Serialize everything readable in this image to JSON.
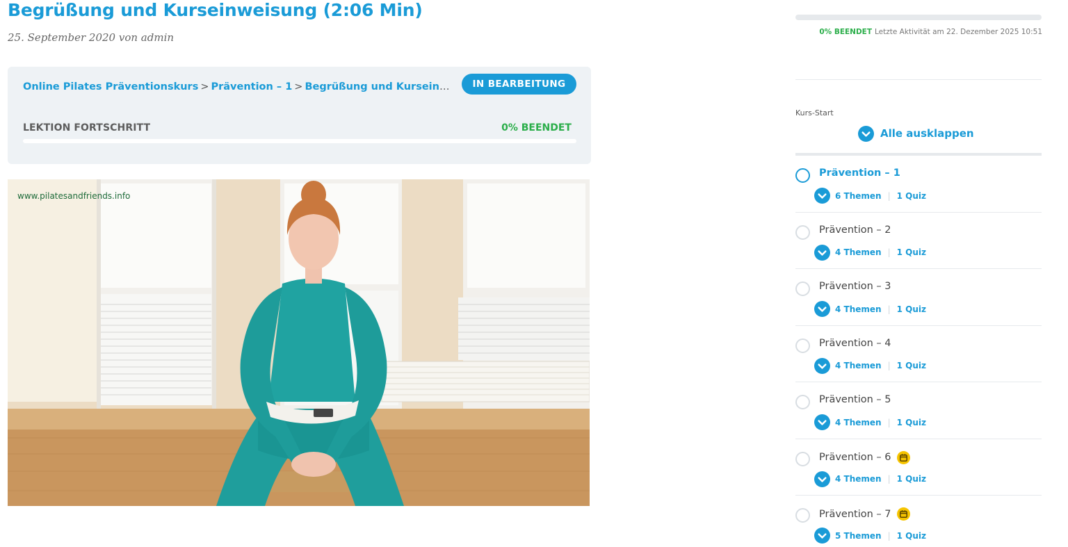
{
  "page": {
    "title": "Begrüßung und Kurseinweisung (2:06 Min)",
    "meta": "25. September 2020 von admin"
  },
  "status_box": {
    "breadcrumb": [
      "Online Pilates Präventionskurs",
      "Prävention – 1",
      "Begrüßung und Kurseinweisung (2:06 Min)"
    ],
    "breadcrumb_separator": ">",
    "badge": "IN BEARBEITUNG",
    "lesson_progress_label": "LEKTION FORTSCHRITT",
    "lesson_progress_text": "0% BEENDET",
    "lesson_progress_value": 0
  },
  "video": {
    "watermark": "www.pilatesandfriends.info"
  },
  "sidebar": {
    "course_progress_value": 0,
    "course_progress_pct": "0% BEENDET",
    "last_activity": "Letzte Aktivität am 22. Dezember 2025 10:51",
    "kurs_start": "Kurs-Start",
    "expand_all": "Alle ausklappen",
    "lessons": [
      {
        "name": "Prävention – 1",
        "themen": "6 Themen",
        "quiz": "1 Quiz",
        "active": true,
        "scheduled": false
      },
      {
        "name": "Prävention – 2",
        "themen": "4 Themen",
        "quiz": "1 Quiz",
        "active": false,
        "scheduled": false
      },
      {
        "name": "Prävention – 3",
        "themen": "4 Themen",
        "quiz": "1 Quiz",
        "active": false,
        "scheduled": false
      },
      {
        "name": "Prävention – 4",
        "themen": "4 Themen",
        "quiz": "1 Quiz",
        "active": false,
        "scheduled": false
      },
      {
        "name": "Prävention – 5",
        "themen": "4 Themen",
        "quiz": "1 Quiz",
        "active": false,
        "scheduled": false
      },
      {
        "name": "Prävention – 6",
        "themen": "4 Themen",
        "quiz": "1 Quiz",
        "active": false,
        "scheduled": true
      },
      {
        "name": "Prävention – 7",
        "themen": "5 Themen",
        "quiz": "1 Quiz",
        "active": false,
        "scheduled": true
      }
    ]
  },
  "colors": {
    "accent": "#1a9bd7",
    "success": "#2bae4a",
    "schedule_badge": "#f6c400"
  },
  "icons": {
    "expand": "chevron-down-circle-icon",
    "schedule": "calendar-clock-icon",
    "status": "status-circle-icon"
  }
}
